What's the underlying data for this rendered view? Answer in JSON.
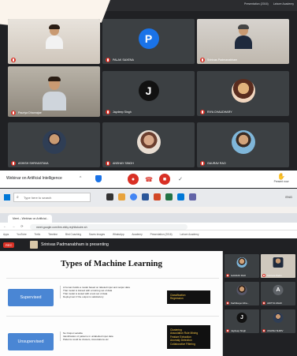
{
  "top": {
    "rec_label": "REC",
    "topbar_items": [
      "Presentation (2016)",
      "Lahore Academy"
    ],
    "tiles": [
      {
        "name": "",
        "kind": "photo"
      },
      {
        "name": "PALAK SAXENA",
        "kind": "letter",
        "letter": "P",
        "color": "#1a73e8"
      },
      {
        "name": "Srinivas Padmanabham",
        "kind": "photo"
      },
      {
        "name": "Pauriya Dhanrajae",
        "kind": "photo"
      },
      {
        "name": "Jaydeep Singh",
        "kind": "letter",
        "letter": "J",
        "color": "#111111"
      },
      {
        "name": "RIYA CHAUDHARY",
        "kind": "round"
      },
      {
        "name": "ASHISH SHRIVASTAVA",
        "kind": "round"
      },
      {
        "name": "ANSHAY SINGH",
        "kind": "round"
      },
      {
        "name": "GAURAV RAO",
        "kind": "round"
      }
    ],
    "meet_title": "Webinar on Artificial Intelligence",
    "present_label": "Present now",
    "taskbar_search": "Type here to search",
    "tray_text": "ENG"
  },
  "bottom": {
    "tab_title": "Meet – Webinar on Artificial...",
    "url": "meet.google.com/bm-ekfq-reyhitukuire-sh",
    "bookmarks": [
      "Apps",
      "YouTube",
      "Trello",
      "Timeline",
      "Bird Coaching",
      "Saves Images",
      "WhatsApp",
      "Academy",
      "Presentation (2016)",
      "Lahore Academy"
    ],
    "rec_label": "REC",
    "presenting_text": "Srinivas Padmanabham is presenting",
    "slide": {
      "title": "Types of Machine Learning",
      "rows": [
        {
          "label": "Supervised",
          "bullets": [
            "A human builds a model based on labeled input and output data",
            "That model is trained with a training set of data",
            "That model is tested with a test set of data",
            "Deployment if the output is satisfactory"
          ],
          "box": [
            "Classification",
            "Regression"
          ]
        },
        {
          "label": "Unsupervised",
          "bullets": [
            "No Output variable",
            "Identification of patterns in unlabelled input data",
            "Patterns could be clusters, Associations etc"
          ],
          "box": [
            "Clustering",
            "Association Rule Mining",
            "Feature Extraction",
            "Anomaly Detection",
            "Collaborative Filtering"
          ]
        }
      ]
    },
    "side_tiles": [
      {
        "name": "GAURAV RAO",
        "kind": "round"
      },
      {
        "name": "Srinivas Padm",
        "kind": "photo"
      },
      {
        "name": "Karthikeya Utha...",
        "kind": "round"
      },
      {
        "name": "ADITYA ASHO",
        "kind": "letter",
        "letter": "A",
        "color": "#5f6368"
      },
      {
        "name": "Jaydeep Singh",
        "kind": "letter",
        "letter": "J",
        "color": "#111111"
      },
      {
        "name": "ASHISH SHRIV",
        "kind": "round"
      }
    ]
  },
  "colors": {
    "meet_dark": "#202124",
    "tile": "#3c4043",
    "red": "#d93025",
    "blue": "#4a86d4",
    "gold": "#f7c744"
  }
}
